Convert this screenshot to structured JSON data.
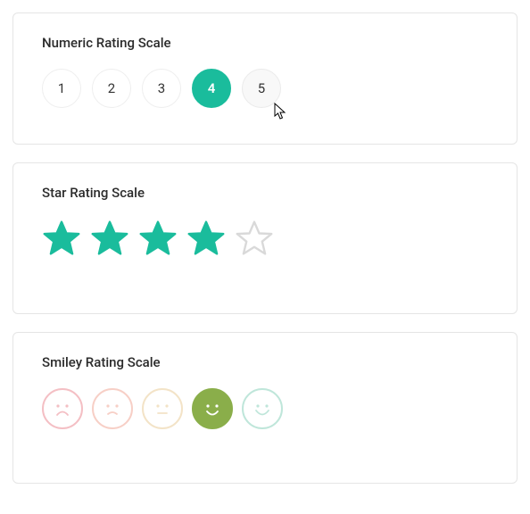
{
  "colors": {
    "accent": "#1abc9c",
    "starFill": "#1abc9c",
    "starEmpty": "#d9d9d9",
    "smiley1": "#f4bfc4",
    "smiley2": "#f7cfc6",
    "smiley3": "#f3e3c7",
    "smiley4": "#8aae4a",
    "smiley5": "#bfe6da"
  },
  "numeric": {
    "title": "Numeric Rating Scale",
    "max": 5,
    "options": [
      "1",
      "2",
      "3",
      "4",
      "5"
    ],
    "selected": 4,
    "hovered": 5
  },
  "star": {
    "title": "Star Rating Scale",
    "max": 5,
    "value": 4
  },
  "smiley": {
    "title": "Smiley Rating Scale",
    "max": 5,
    "value": 4,
    "faces": [
      "sad",
      "slightly-sad",
      "neutral",
      "happy",
      "very-happy"
    ]
  }
}
